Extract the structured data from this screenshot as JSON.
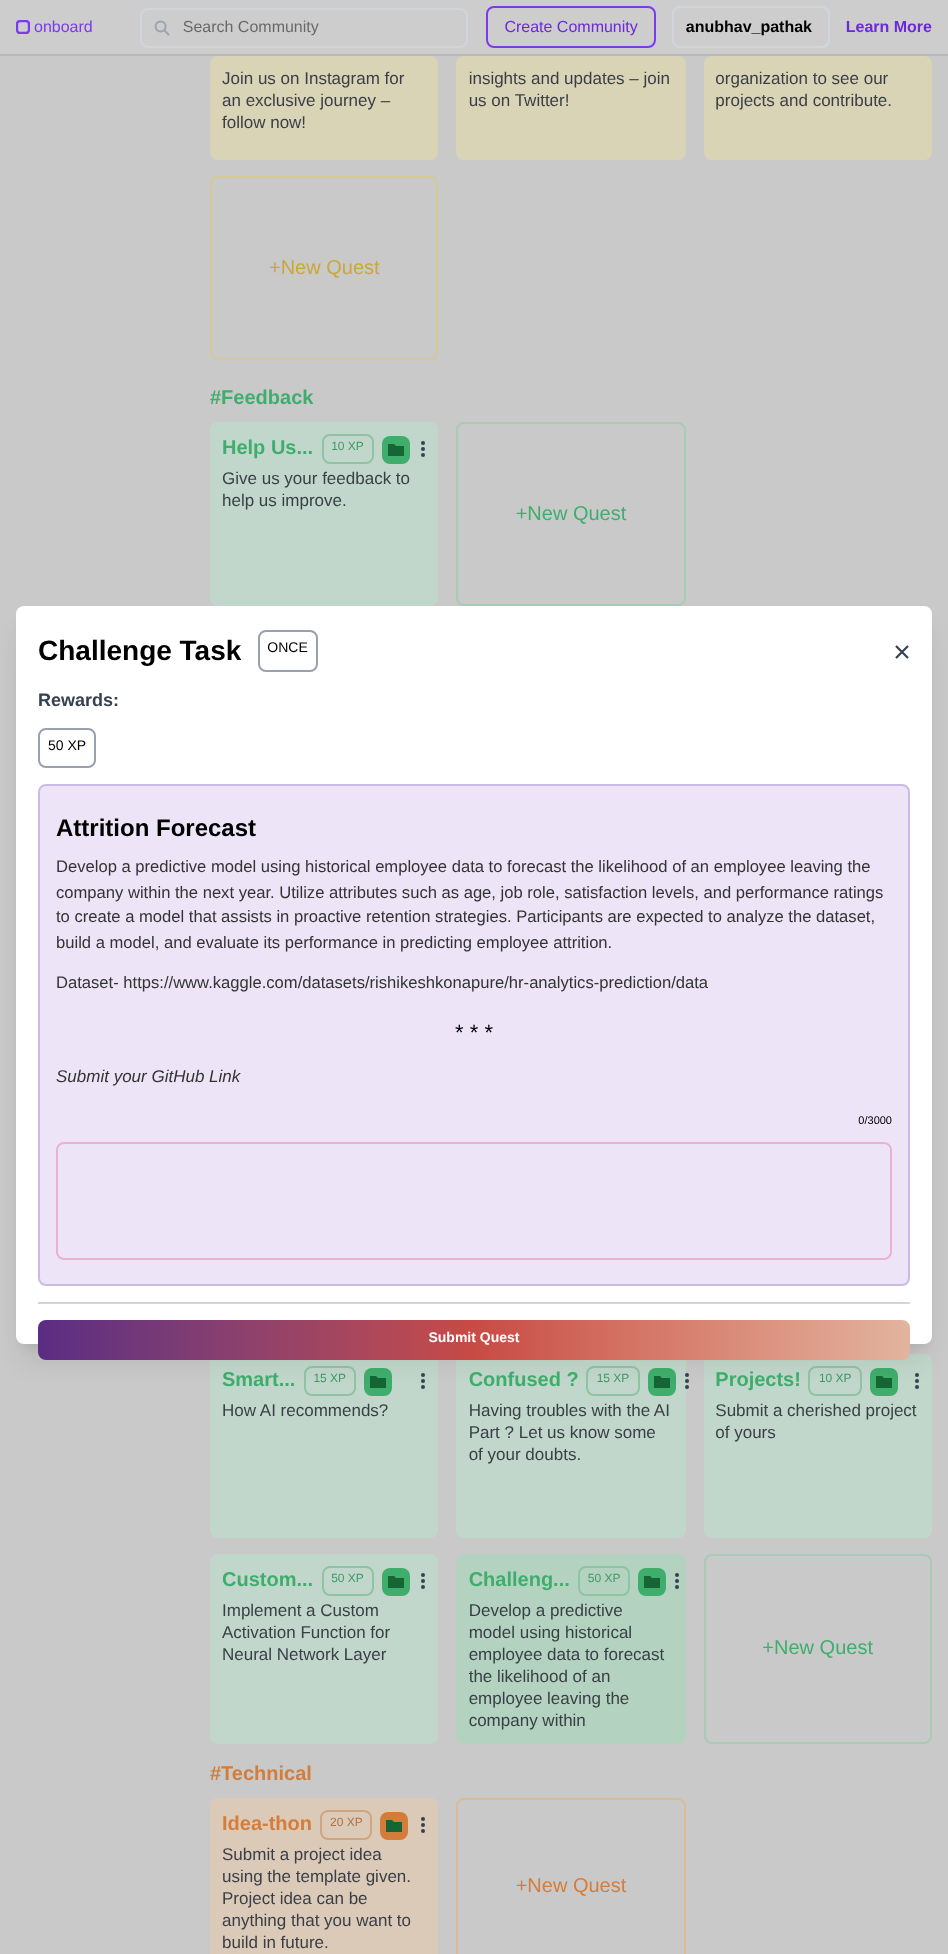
{
  "header": {
    "logo": "onboard",
    "search": {
      "placeholder": "Search Community"
    },
    "create_button": "Create Community",
    "user": "anubhav_pathak",
    "learn_more": "Learn More"
  },
  "sections": [
    {
      "color": "#c9a838",
      "cards": [
        {
          "kind": "quest",
          "selected": false,
          "description": "Join us on Instagram for an exclusive journey – follow now!"
        },
        {
          "kind": "quest",
          "selected": false,
          "description": "insights and updates – join us on Twitter!"
        },
        {
          "kind": "quest",
          "selected": false,
          "description": "organization to see our projects and contribute."
        },
        {
          "kind": "new",
          "label": "+New Quest"
        }
      ]
    },
    {
      "heading": "#Feedback",
      "color": "#3fae6c",
      "cards": [
        {
          "kind": "quest",
          "selected": false,
          "title": "Help Us...",
          "xp": "10 XP",
          "description": "Give us your feedback to help us improve."
        },
        {
          "kind": "new",
          "label": "+New Quest"
        }
      ]
    },
    {
      "color": "#3fae6c",
      "cards": [
        {
          "kind": "quest",
          "selected": false,
          "title": "Smart...",
          "xp": "15 XP",
          "description": "How AI recommends?"
        },
        {
          "kind": "quest",
          "selected": false,
          "title": "Confused ?",
          "xp": "15 XP",
          "description": "Having troubles with the AI Part ? Let us know some of your doubts."
        },
        {
          "kind": "quest",
          "selected": false,
          "title": "Projects!",
          "xp": "10 XP",
          "description": "Submit a cherished project of yours"
        },
        {
          "kind": "quest",
          "selected": false,
          "title": "Custom...",
          "xp": "50 XP",
          "description": "Implement a Custom Activation Function for Neural Network Layer"
        },
        {
          "kind": "quest",
          "selected": true,
          "title": "Challeng...",
          "xp": "50 XP",
          "description": "Develop a predictive model using historical employee data to forecast the likelihood of an employee leaving the company within"
        },
        {
          "kind": "new",
          "label": "+New Quest"
        }
      ]
    },
    {
      "heading": "#Technical",
      "color": "#d47d3a",
      "cards": [
        {
          "kind": "quest",
          "selected": false,
          "title": "Idea-thon",
          "xp": "20 XP",
          "description": "Submit a project idea using the template given. Project idea can be anything that you want to build in future."
        },
        {
          "kind": "new",
          "label": "+New Quest"
        }
      ]
    }
  ],
  "modal": {
    "title": "Challenge Task",
    "frequency": "ONCE",
    "rewards_label": "Rewards:",
    "reward": "50 XP",
    "task": {
      "title": "Attrition Forecast",
      "description": "Develop a predictive model using historical employee data to forecast the likelihood of an employee leaving the company within the next year. Utilize attributes such as age, job role, satisfaction levels, and performance ratings to create a model that assists in proactive retention strategies. Participants are expected to analyze the dataset, build a model, and evaluate its performance in predicting employee attrition.",
      "dataset": "Dataset- https://www.kaggle.com/datasets/rishikeshkonapure/hr-analytics-prediction/data",
      "separator": "* * *",
      "prompt": "Submit your GitHub Link",
      "counter": "0/3000"
    },
    "submit_button": "Submit Quest"
  }
}
